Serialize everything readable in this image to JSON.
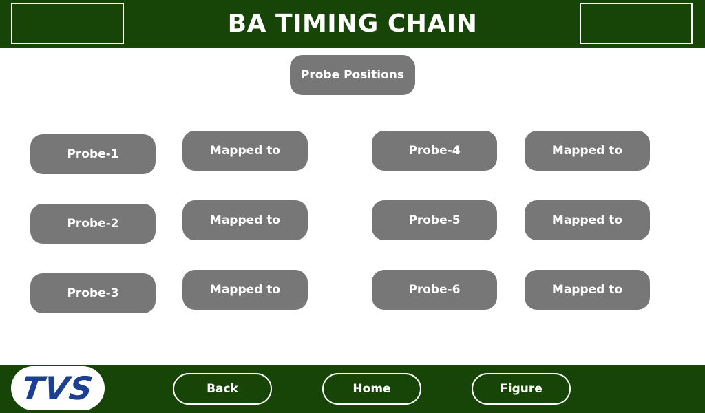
{
  "header": {
    "title": "BA TIMING CHAIN"
  },
  "main": {
    "probe_positions_label": "Probe Positions",
    "probes": [
      {
        "label": "Probe-1",
        "mapped_label": "Mapped to"
      },
      {
        "label": "Probe-2",
        "mapped_label": "Mapped to"
      },
      {
        "label": "Probe-3",
        "mapped_label": "Mapped to"
      },
      {
        "label": "Probe-4",
        "mapped_label": "Mapped to"
      },
      {
        "label": "Probe-5",
        "mapped_label": "Mapped to"
      },
      {
        "label": "Probe-6",
        "mapped_label": "Mapped to"
      }
    ]
  },
  "footer": {
    "logo_text": "TVS",
    "back_label": "Back",
    "home_label": "Home",
    "figure_label": "Figure"
  },
  "colors": {
    "header_green": "#174507",
    "button_gray": "#777777",
    "logo_blue": "#1d3f91"
  }
}
